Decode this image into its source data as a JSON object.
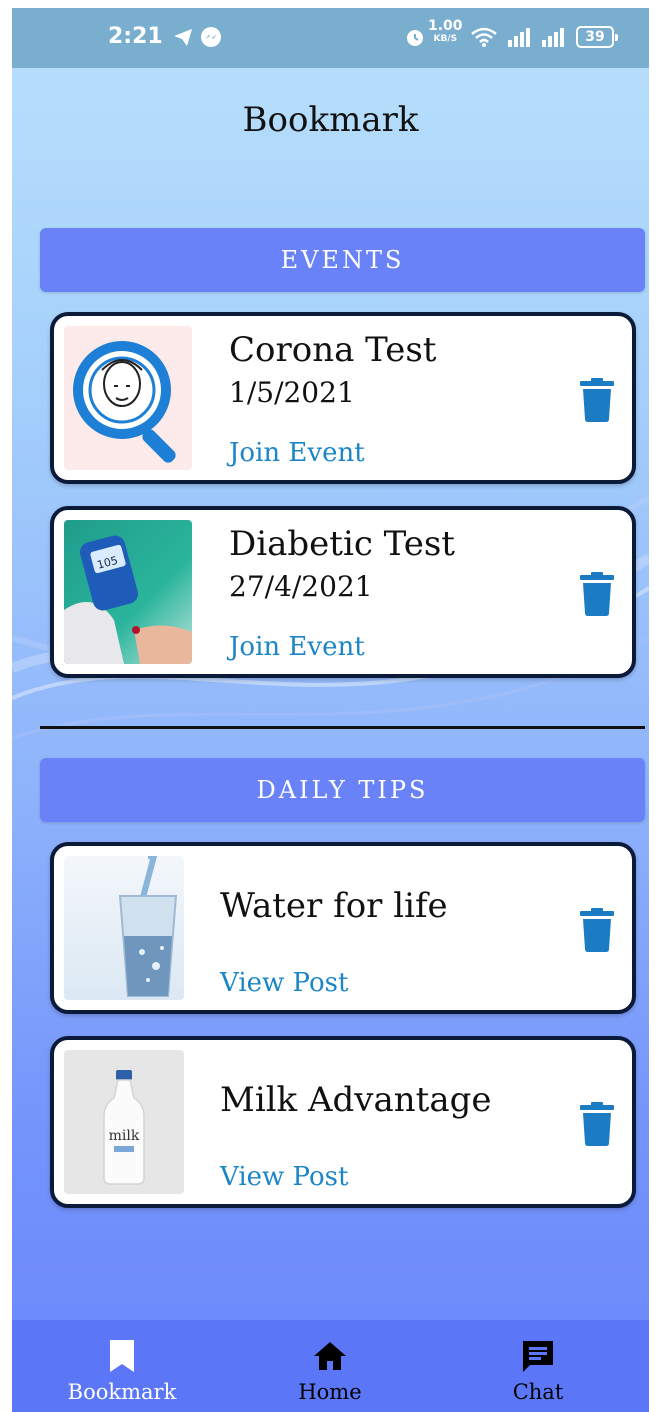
{
  "status_bar": {
    "time": "2:21",
    "speed": "1.00",
    "speed_unit": "KB/S",
    "battery": "39"
  },
  "page": {
    "title": "Bookmark"
  },
  "events": {
    "header": "EVENTS",
    "items": [
      {
        "title": "Corona Test",
        "date": "1/5/2021",
        "action": "Join Event"
      },
      {
        "title": "Diabetic Test",
        "date": "27/4/2021",
        "action": "Join Event"
      }
    ]
  },
  "tips": {
    "header": "DAILY TIPS",
    "items": [
      {
        "title": "Water for life",
        "action": "View Post"
      },
      {
        "title": "Milk Advantage",
        "action": "View Post",
        "image_text": "milk"
      }
    ]
  },
  "nav": {
    "items": [
      {
        "label": "Bookmark",
        "icon": "bookmark-icon",
        "active": true
      },
      {
        "label": "Home",
        "icon": "home-icon",
        "active": false
      },
      {
        "label": "Chat",
        "icon": "chat-icon",
        "active": false
      }
    ]
  },
  "colors": {
    "accent": "#6a82f7",
    "link": "#1b86c7",
    "trash": "#1b7cc4",
    "nav_bg": "#5b77f8"
  }
}
